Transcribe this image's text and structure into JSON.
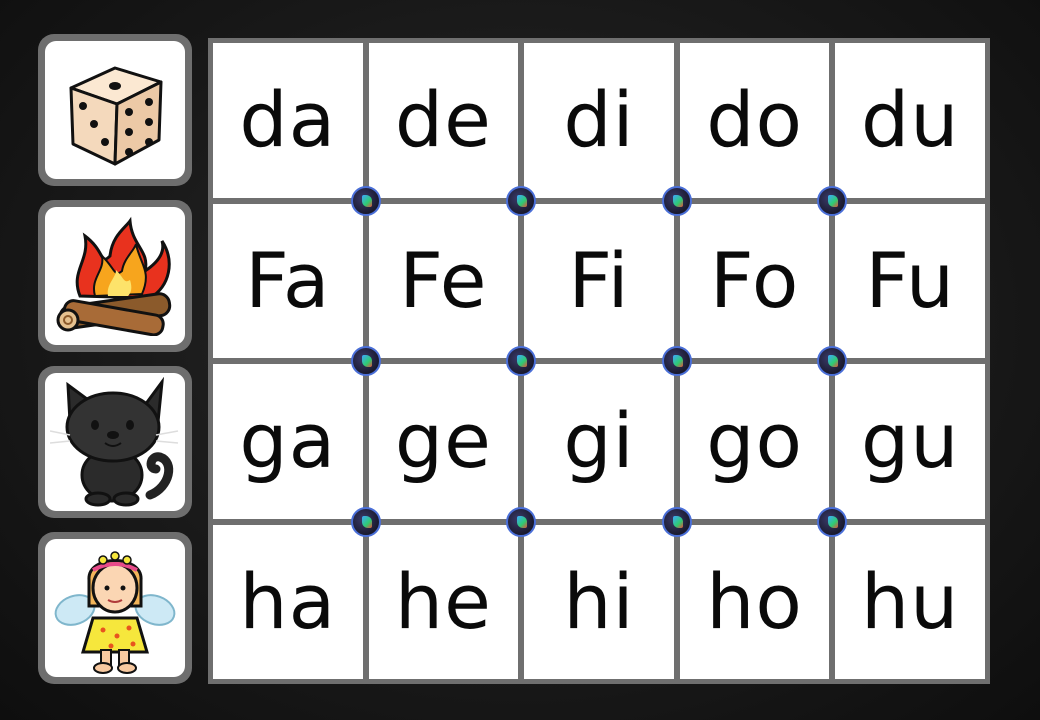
{
  "picture_column": [
    {
      "name": "dice"
    },
    {
      "name": "campfire"
    },
    {
      "name": "black-cat"
    },
    {
      "name": "fairy"
    }
  ],
  "syllable_grid": {
    "rows": [
      [
        "da",
        "de",
        "di",
        "do",
        "du"
      ],
      [
        "Fa",
        "Fe",
        "Fi",
        "Fo",
        "Fu"
      ],
      [
        "ga",
        "ge",
        "gi",
        "go",
        "gu"
      ],
      [
        "ha",
        "he",
        "hi",
        "ho",
        "hu"
      ]
    ]
  },
  "colors": {
    "background": "#1a1a1a",
    "frame": "#6f6f6f",
    "card": "#ffffff",
    "text": "#0a0a0a",
    "badge_border": "#4a6fd8"
  }
}
